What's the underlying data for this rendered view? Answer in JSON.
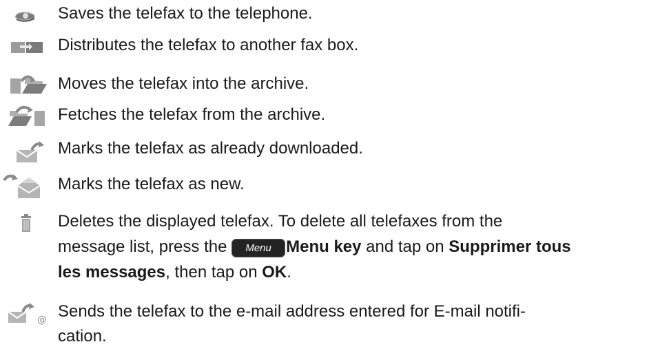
{
  "items": [
    {
      "icon": "save-to-phone-icon",
      "text": "Saves the telefax to the telephone."
    },
    {
      "icon": "forward-to-fax-box-icon",
      "text": "Distributes the telefax to another fax box."
    },
    {
      "icon": "move-to-archive-icon",
      "text": "Moves the telefax into the archive."
    },
    {
      "icon": "fetch-from-archive-icon",
      "text": "Fetches the telefax from the archive."
    },
    {
      "icon": "mark-downloaded-icon",
      "text": "Marks the telefax as already downloaded."
    },
    {
      "icon": "mark-new-icon",
      "text": "Marks the telefax as new."
    },
    {
      "icon": "trash-icon",
      "line1": "Deletes the displayed telefax. To delete all telefaxes from the",
      "line2_a": "message list, press the",
      "menu_key_label": "Menu",
      "line2_b": "Menu key",
      "line2_c": " and tap on ",
      "line2_d": "Supprimer tous",
      "line3_a": "les messages",
      "line3_b": ", then tap on ",
      "line3_c": "OK",
      "line3_d": "."
    },
    {
      "icon": "email-forward-icon",
      "line1": "Sends the telefax to the e-mail address entered for E-mail notifi-",
      "line2": "cation."
    }
  ],
  "colors": {
    "text": "#1a1a1a",
    "icon_gray": "#8a8a8a",
    "menu_key_bg": "#232323"
  }
}
